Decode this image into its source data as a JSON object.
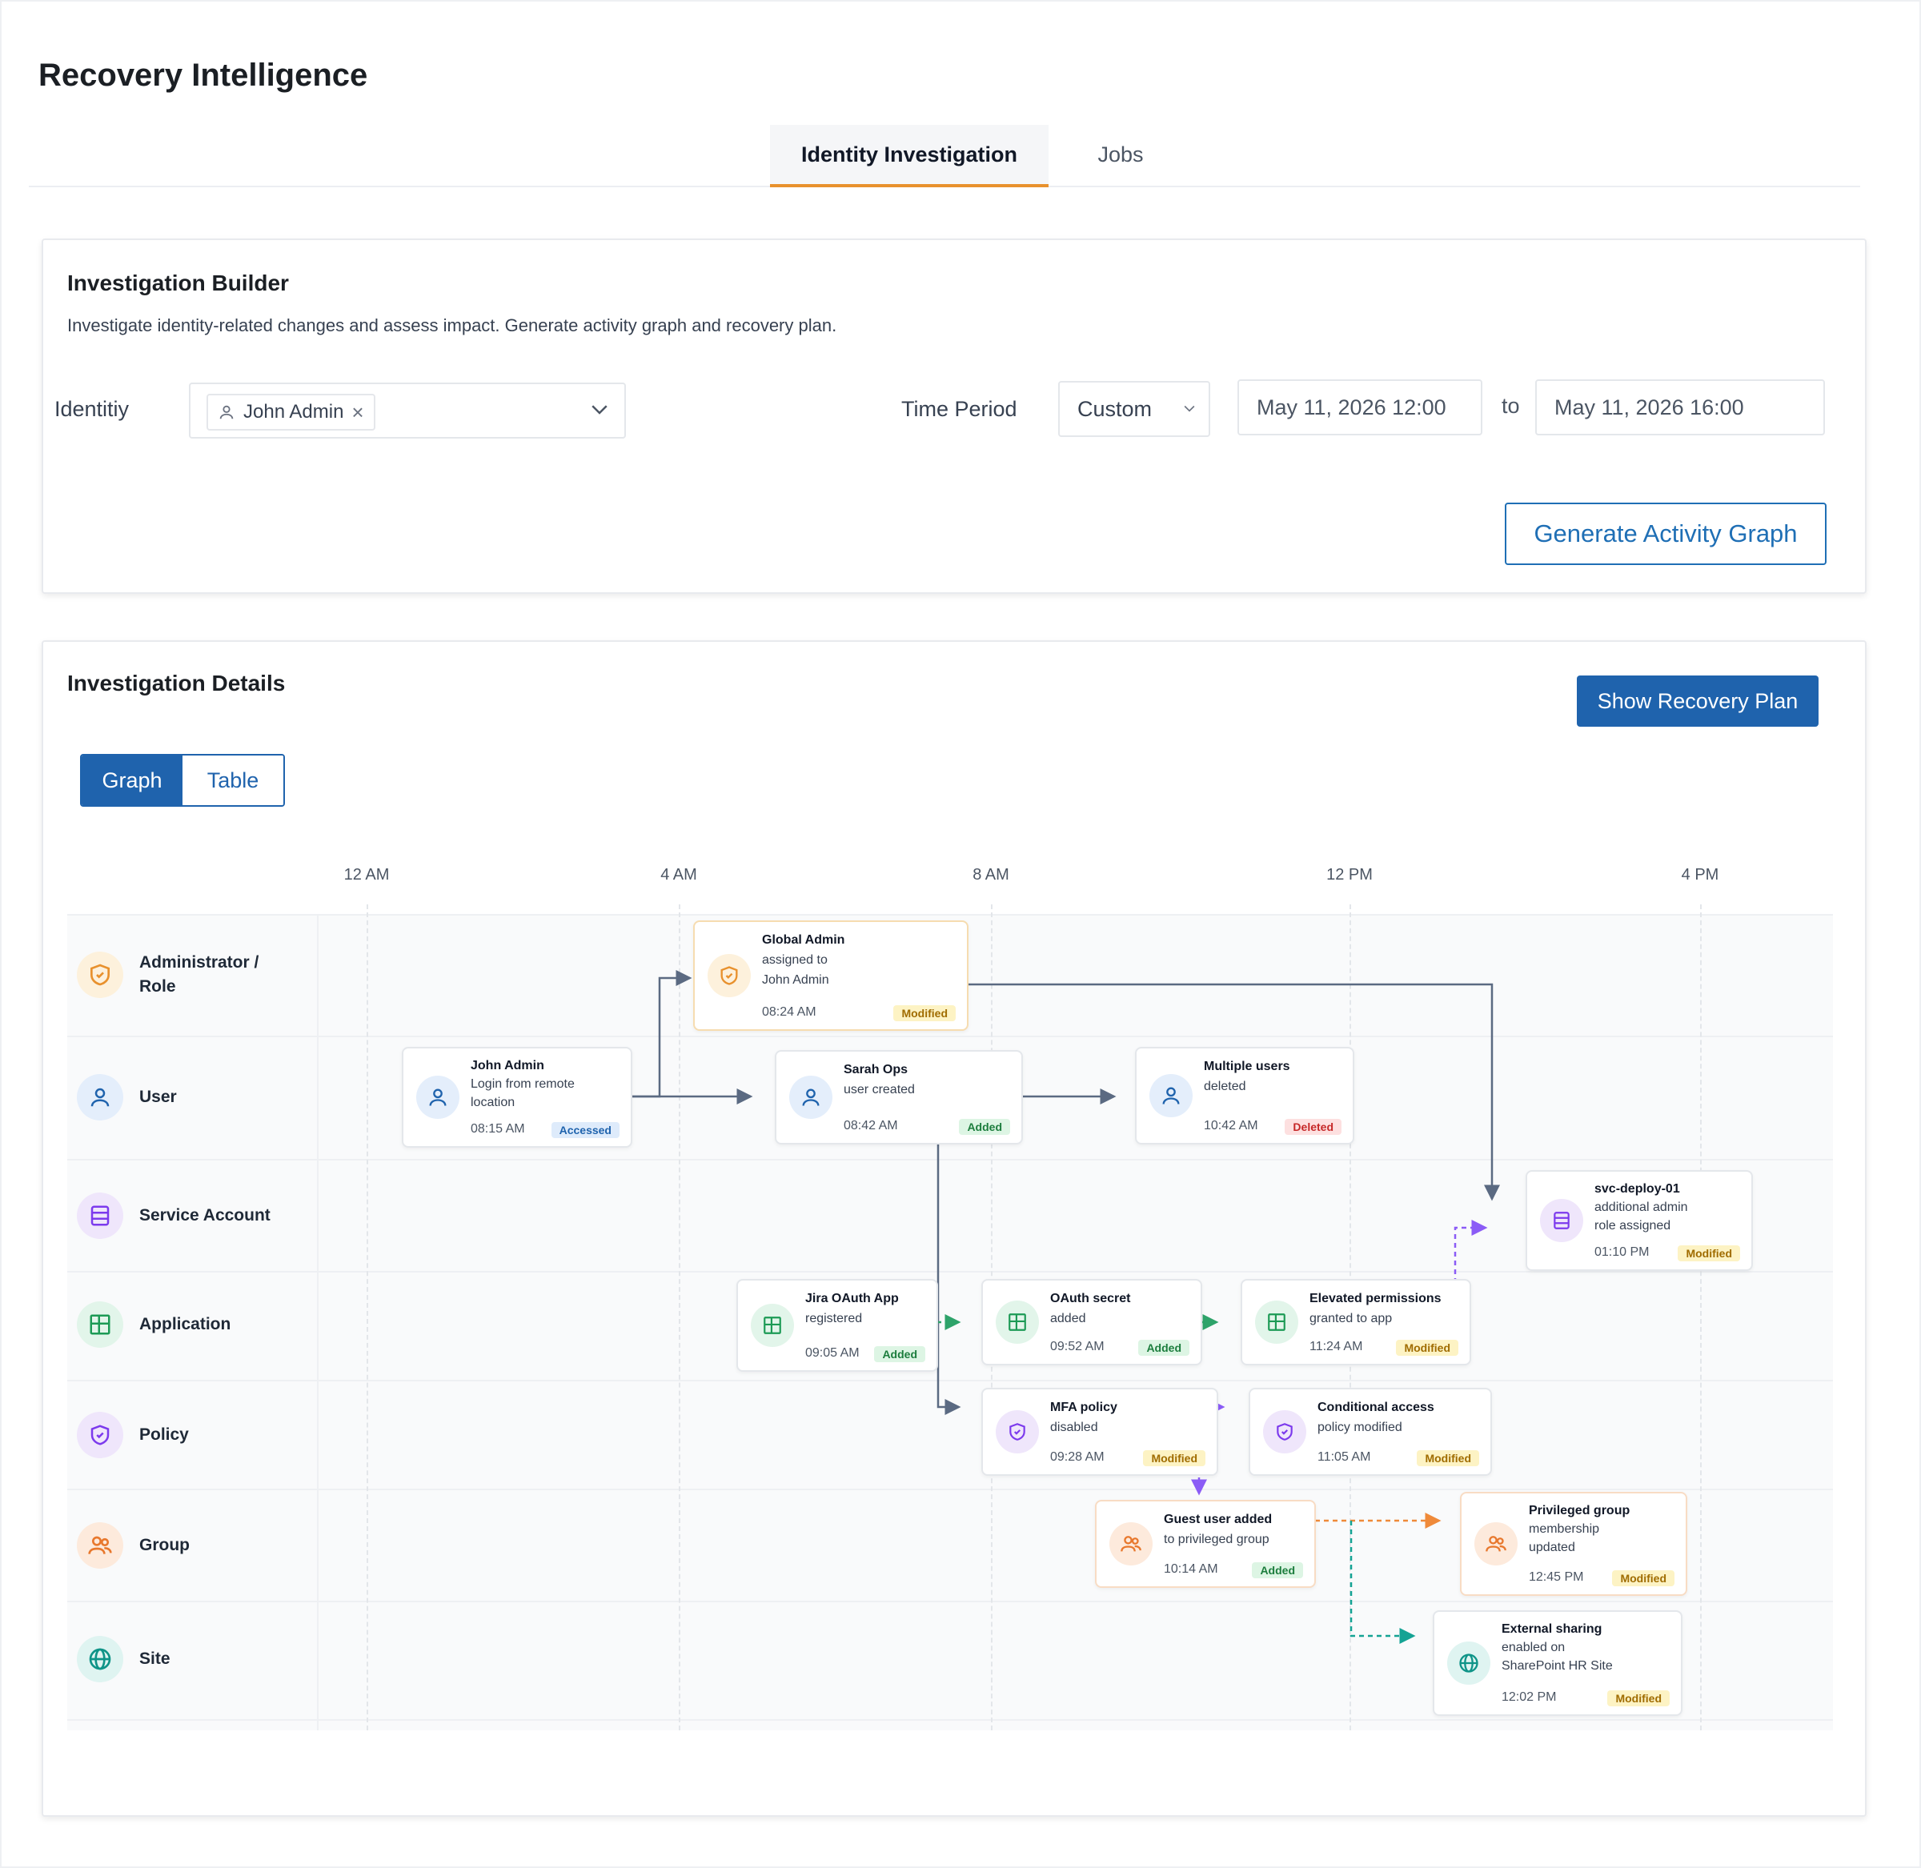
{
  "app": {
    "title": "Recovery Intelligence"
  },
  "tabs": [
    {
      "label": "Identity Investigation",
      "active": true
    },
    {
      "label": "Jobs",
      "active": false
    }
  ],
  "builder": {
    "title": "Investigation Builder",
    "description": "Investigate identity-related changes and assess impact. Generate activity graph and recovery plan.",
    "identity_label": "Identitiy",
    "identity_value": "John Admin",
    "time_period_label": "Time Period",
    "time_period_value": "Custom",
    "from_value": "May 11, 2026 12:00",
    "to_label": "to",
    "to_value": "May 11, 2026 16:00",
    "generate_button": "Generate Activity Graph"
  },
  "details": {
    "title": "Investigation  Details",
    "recovery_button": "Show Recovery Plan",
    "view_toggle": [
      "Graph",
      "Table"
    ],
    "active_view": "Graph"
  },
  "graph": {
    "time_ticks": [
      "12 AM",
      "4 AM",
      "8 AM",
      "12 PM",
      "4 PM"
    ],
    "rows": [
      {
        "label": "Administrator / Role",
        "icon": "shield-icon"
      },
      {
        "label": "User",
        "icon": "user-icon"
      },
      {
        "label": "Service Account",
        "icon": "server-icon"
      },
      {
        "label": "Application",
        "icon": "app-grid-icon"
      },
      {
        "label": "Policy",
        "icon": "shield-check-icon"
      },
      {
        "label": "Group",
        "icon": "group-icon"
      },
      {
        "label": "Site",
        "icon": "globe-icon"
      }
    ],
    "nodes": [
      {
        "id": "n1",
        "lines": [
          "Global Admin",
          "assigned to",
          "John Admin"
        ],
        "time": "08:24 AM",
        "status": "Modified"
      },
      {
        "id": "n2",
        "lines": [
          "John Admin",
          "Login from remote",
          "location"
        ],
        "time": "08:15 AM",
        "status": "Accessed"
      },
      {
        "id": "n3",
        "lines": [
          "Sarah Ops",
          "user created"
        ],
        "time": "08:42 AM",
        "status": "Added"
      },
      {
        "id": "n4",
        "lines": [
          "Multiple users",
          "deleted"
        ],
        "time": "10:42 AM",
        "status": "Deleted"
      },
      {
        "id": "n5",
        "lines": [
          "svc-deploy-01",
          "additional admin",
          "role assigned"
        ],
        "time": "01:10 PM",
        "status": "Modified"
      },
      {
        "id": "n6",
        "lines": [
          "Jira OAuth App",
          "registered"
        ],
        "time": "09:05 AM",
        "status": "Added"
      },
      {
        "id": "n7",
        "lines": [
          "OAuth secret",
          "added"
        ],
        "time": "09:52 AM",
        "status": "Added"
      },
      {
        "id": "n8",
        "lines": [
          "Elevated permissions",
          "granted to app"
        ],
        "time": "11:24 AM",
        "status": "Modified"
      },
      {
        "id": "n9",
        "lines": [
          "MFA policy",
          "disabled"
        ],
        "time": "09:28 AM",
        "status": "Modified"
      },
      {
        "id": "n10",
        "lines": [
          "Conditional access",
          "policy modified"
        ],
        "time": "11:05 AM",
        "status": "Modified"
      },
      {
        "id": "n11",
        "lines": [
          "Guest user added",
          "to privileged group"
        ],
        "time": "10:14 AM",
        "status": "Added"
      },
      {
        "id": "n12",
        "lines": [
          "Privileged group",
          "membership",
          "updated"
        ],
        "time": "12:45 PM",
        "status": "Modified"
      },
      {
        "id": "n13",
        "lines": [
          "External sharing",
          "enabled on",
          "SharePoint HR Site"
        ],
        "time": "12:02 PM",
        "status": "Modified"
      }
    ]
  },
  "colors": {
    "accent": "#1f63ad",
    "tab_underline": "#e8912d",
    "modified": "#a06c00",
    "added": "#1c7d3d",
    "deleted": "#c62828",
    "accessed": "#1f63ad"
  }
}
